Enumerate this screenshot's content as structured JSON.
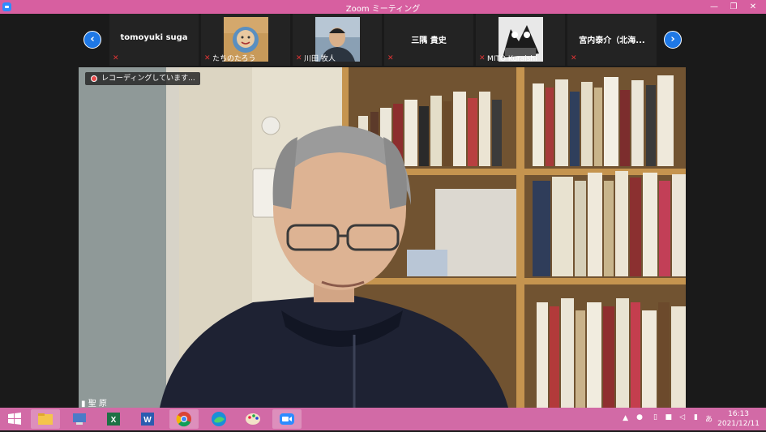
{
  "window": {
    "title": "Zoom ミーティング",
    "controls": [
      "—",
      "❐",
      "✕"
    ]
  },
  "gallery": {
    "prev_label": "‹",
    "next_label": "›",
    "participants": [
      {
        "name": "tomoyuki suga",
        "label": ""
      },
      {
        "name": "",
        "label": "たちのたろう"
      },
      {
        "name": "",
        "label": "川田 牧人"
      },
      {
        "name": "三隅 貴史",
        "label": ""
      },
      {
        "name": "",
        "label": "MITO Kuraishi"
      },
      {
        "name": "宮内泰介（北海...",
        "label": ""
      }
    ]
  },
  "main": {
    "recording_label": "レコーディングしています...",
    "speaker_name": "聖 原"
  },
  "taskbar": {
    "apps": [
      "windows-start",
      "file-explorer",
      "network-app",
      "excel",
      "word",
      "chrome",
      "edge",
      "paint",
      "zoom"
    ],
    "tray": {
      "ime": "あ"
    },
    "clock": {
      "time": "16:13",
      "date": "2021/12/11"
    }
  },
  "colors": {
    "titlebar": "#d75fa0",
    "taskbar": "#d26aa6",
    "accent": "#1e78e6",
    "muted": "#e03434"
  }
}
